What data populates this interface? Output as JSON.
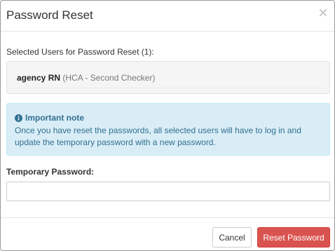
{
  "modal": {
    "title": "Password Reset"
  },
  "selected_users": {
    "label": "Selected Users for Password Reset (1):",
    "users": [
      {
        "name": "agency RN",
        "role": "(HCA - Second Checker)"
      }
    ]
  },
  "note": {
    "title": "Important note",
    "body": "Once you have reset the passwords, all selected users will have to log in and update the temporary password with a new password."
  },
  "temp_password": {
    "label": "Temporary Password:",
    "value": "",
    "placeholder": ""
  },
  "footer": {
    "cancel_label": "Cancel",
    "reset_label": "Reset Password"
  },
  "colors": {
    "alert_bg": "#d9edf7",
    "alert_text": "#31708f",
    "danger": "#d9534f"
  },
  "icons": {
    "close": "close-icon",
    "info": "info-circle-icon"
  }
}
